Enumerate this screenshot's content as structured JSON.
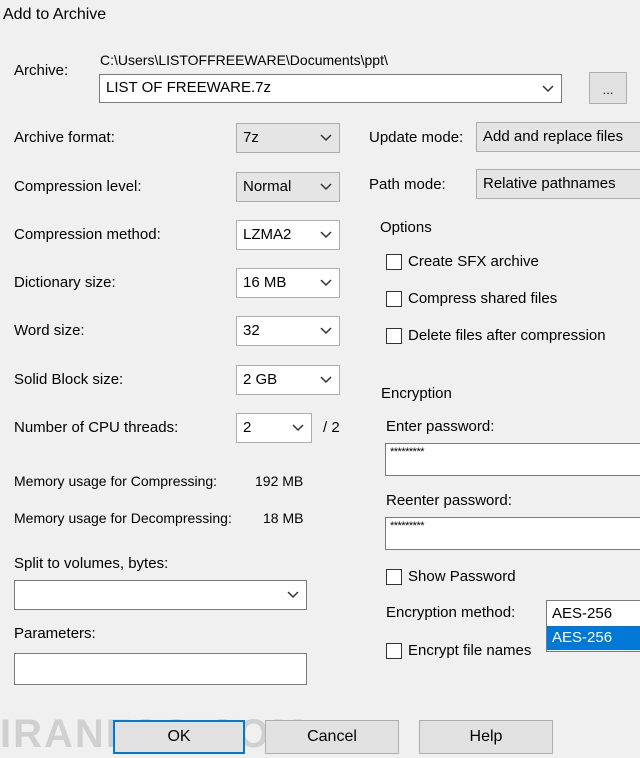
{
  "window": {
    "title": "Add to Archive"
  },
  "archive": {
    "label": "Archive:",
    "path": "C:\\Users\\LISTOFFREEWARE\\Documents\\ppt\\",
    "filename": "LIST OF FREEWARE.7z",
    "browse_label": "..."
  },
  "left": {
    "format": {
      "label": "Archive format:",
      "value": "7z"
    },
    "level": {
      "label": "Compression level:",
      "value": "Normal"
    },
    "method": {
      "label": "Compression method:",
      "value": "LZMA2"
    },
    "dictionary": {
      "label": "Dictionary size:",
      "value": "16 MB"
    },
    "word": {
      "label": "Word size:",
      "value": "32"
    },
    "solid": {
      "label": "Solid Block size:",
      "value": "2 GB"
    },
    "threads": {
      "label": "Number of CPU threads:",
      "value": "2",
      "max": "/ 2"
    },
    "mem_compress": {
      "label": "Memory usage for Compressing:",
      "value": "192 MB"
    },
    "mem_decompress": {
      "label": "Memory usage for Decompressing:",
      "value": "18 MB"
    },
    "split": {
      "label": "Split to volumes, bytes:",
      "value": ""
    },
    "params": {
      "label": "Parameters:",
      "value": ""
    }
  },
  "right": {
    "update_mode": {
      "label": "Update mode:",
      "value": "Add and replace files"
    },
    "path_mode": {
      "label": "Path mode:",
      "value": "Relative pathnames"
    },
    "options": {
      "title": "Options",
      "sfx": {
        "label": "Create SFX archive",
        "checked": false
      },
      "shared": {
        "label": "Compress shared files",
        "checked": false
      },
      "delete": {
        "label": "Delete files after compression",
        "checked": false
      }
    },
    "encryption": {
      "title": "Encryption",
      "enter_label": "Enter password:",
      "enter_value": "*********",
      "reenter_label": "Reenter password:",
      "reenter_value": "*********",
      "show_password": {
        "label": "Show Password",
        "checked": false
      },
      "method_label": "Encryption method:",
      "method_value": "AES-256",
      "method_options": [
        "AES-256"
      ],
      "encrypt_names": {
        "label": "Encrypt file names",
        "checked": false
      }
    }
  },
  "buttons": {
    "ok": "OK",
    "cancel": "Cancel",
    "help": "Help"
  },
  "watermark": "IRANFSO.COM",
  "colors": {
    "selection": "#0078d7",
    "focus_border": "#0078d7",
    "background": "#f0f0f0"
  }
}
